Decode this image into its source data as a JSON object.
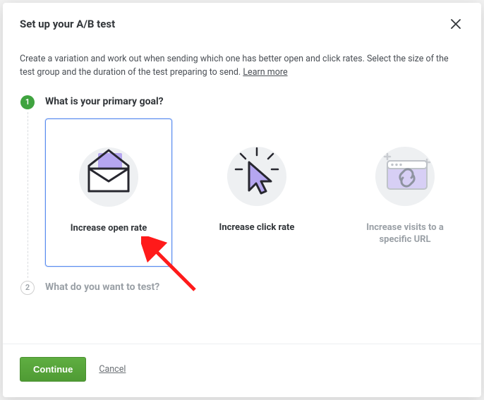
{
  "header": {
    "title": "Set up your A/B test"
  },
  "intro": {
    "text": "Create a variation and work out when sending which one has better open and click rates. Select the size of the test group and the duration of the test preparing to send. ",
    "learn_more": "Learn more"
  },
  "steps": {
    "s1": {
      "number": "1",
      "title": "What is your primary goal?",
      "goals": [
        {
          "label": "Increase open rate"
        },
        {
          "label": "Increase click rate"
        },
        {
          "label": "Increase visits to a specific URL"
        }
      ]
    },
    "s2": {
      "number": "2",
      "title": "What do you want to test?"
    }
  },
  "footer": {
    "continue_label": "Continue",
    "cancel_label": "Cancel"
  }
}
